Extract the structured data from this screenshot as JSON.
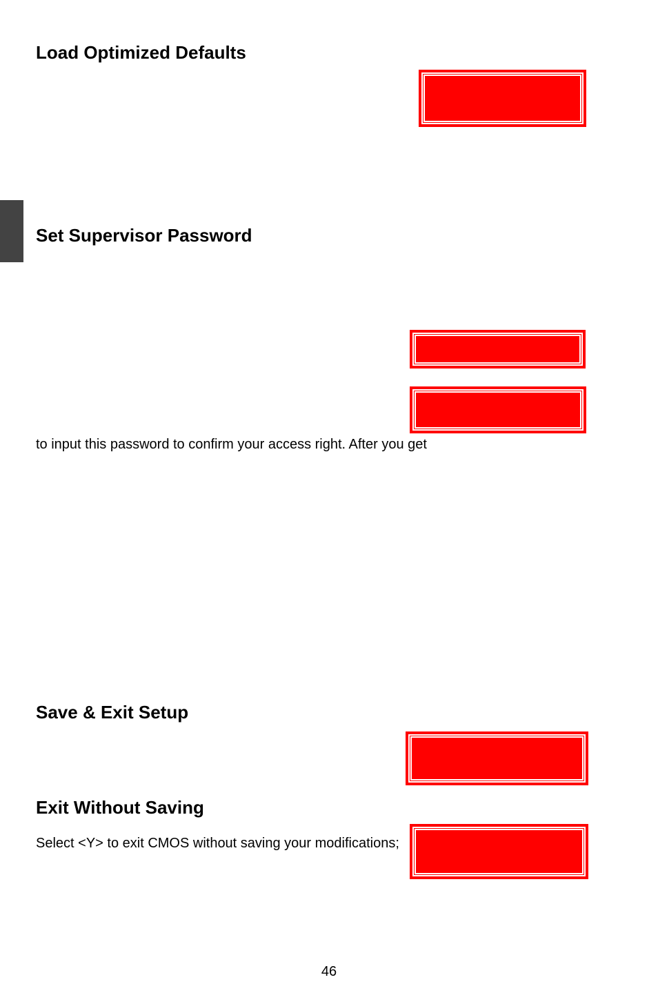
{
  "headings": {
    "load_optimized_defaults": "Load Optimized Defaults",
    "set_supervisor_password": "Set Supervisor Password",
    "save_exit_setup": "Save & Exit Setup",
    "exit_without_saving": "Exit Without Saving"
  },
  "paragraphs": {
    "access_right": "to input this password to confirm your access right. After you get",
    "exit_without_saving": "Select <Y> to exit CMOS without saving your modifications;"
  },
  "page_number": "46"
}
